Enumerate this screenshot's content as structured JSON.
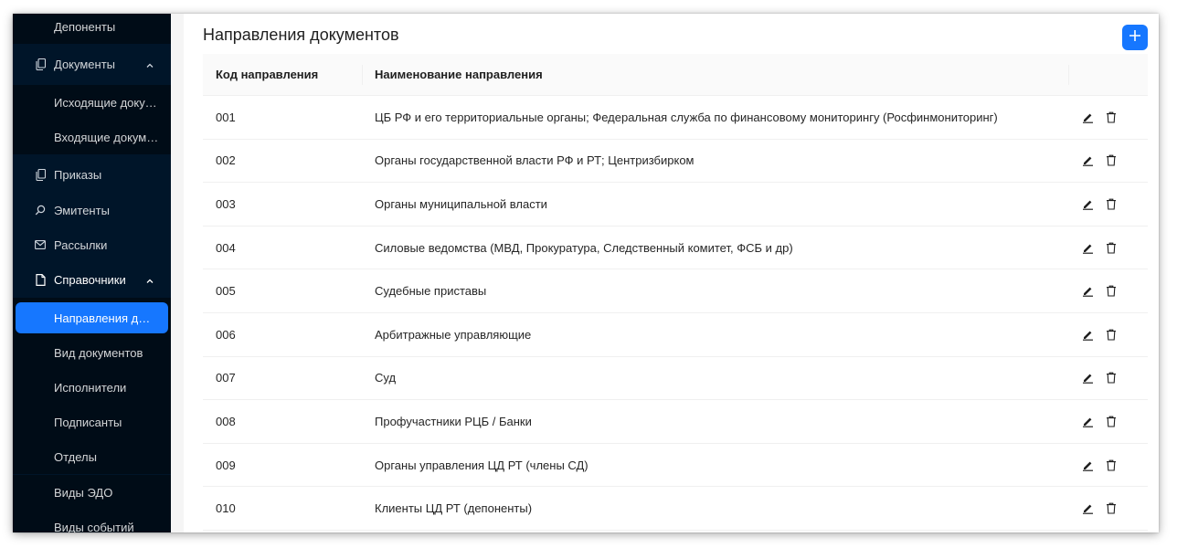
{
  "sidebar": {
    "items": [
      {
        "label": "Депоненты"
      },
      {
        "label": "Документы",
        "icon": "document-icon"
      },
      {
        "label": "Исходящие документы"
      },
      {
        "label": "Входящие документы"
      },
      {
        "label": "Приказы",
        "icon": "document-icon"
      },
      {
        "label": "Эмитенты",
        "icon": "search-icon"
      },
      {
        "label": "Рассылки",
        "icon": "mail-icon"
      },
      {
        "label": "Справочники",
        "icon": "file-icon"
      },
      {
        "label": "Направления документов"
      },
      {
        "label": "Вид документов"
      },
      {
        "label": "Исполнители"
      },
      {
        "label": "Подписанты"
      },
      {
        "label": "Отделы"
      },
      {
        "label": "Виды ЭДО"
      },
      {
        "label": "Виды событий"
      }
    ]
  },
  "page": {
    "title": "Направления документов",
    "add_icon": "plus-icon"
  },
  "table": {
    "columns": [
      "Код направления",
      "Наименование направления"
    ],
    "rows": [
      {
        "code": "001",
        "name": "ЦБ РФ и его территориальные органы; Федеральная служба по финансовому мониторингу (Росфинмониторинг)"
      },
      {
        "code": "002",
        "name": "Органы государственной власти РФ и РТ; Центризбирком"
      },
      {
        "code": "003",
        "name": "Органы муниципальной власти"
      },
      {
        "code": "004",
        "name": "Силовые ведомства (МВД, Прокуратура, Следственный комитет, ФСБ и др)"
      },
      {
        "code": "005",
        "name": "Судебные приставы"
      },
      {
        "code": "006",
        "name": "Арбитражные управляющие"
      },
      {
        "code": "007",
        "name": "Суд"
      },
      {
        "code": "008",
        "name": "Профучастники РЦБ / Банки"
      },
      {
        "code": "009",
        "name": "Органы управления ЦД РТ (члены СД)"
      },
      {
        "code": "010",
        "name": "Клиенты ЦД РТ (депоненты)"
      }
    ],
    "row_actions": [
      "edit-icon",
      "delete-icon"
    ]
  },
  "colors": {
    "sidebar_bg": "#001529",
    "submenu_bg": "#000c17",
    "accent": "#1677ff"
  }
}
